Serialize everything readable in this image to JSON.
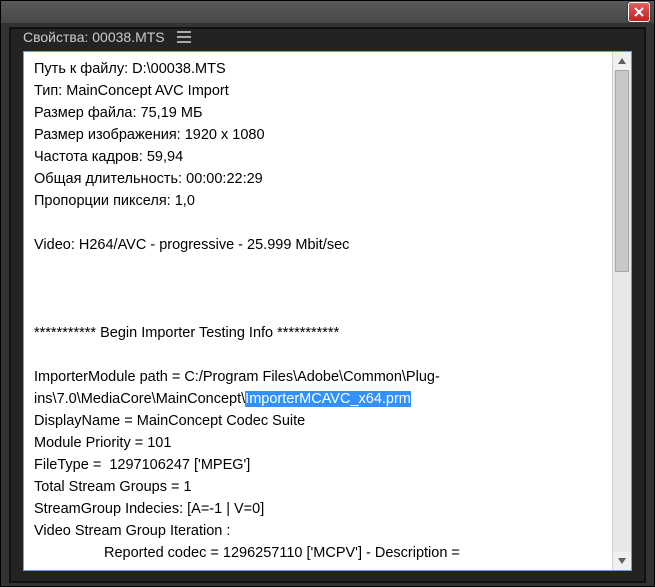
{
  "window": {
    "close_label": "Close"
  },
  "panel": {
    "title": "Свойства: 00038.MTS"
  },
  "props": {
    "file_path_label": "Путь к файлу:",
    "file_path_value": "D:\\00038.MTS",
    "type_label": "Тип:",
    "type_value": "MainConcept AVC Import",
    "file_size_label": "Размер файла:",
    "file_size_value": "75,19 МБ",
    "image_size_label": "Размер изображения:",
    "image_size_value": "1920 x 1080",
    "frame_rate_label": "Частота кадров:",
    "frame_rate_value": "59,94",
    "duration_label": "Общая длительность:",
    "duration_value": "00:00:22:29",
    "pixel_aspect_label": "Пропорции пикселя:",
    "pixel_aspect_value": "1,0",
    "video_line": "Video: H264/AVC - progressive - 25.999 Mbit/sec",
    "separator_line": "*********** Begin Importer Testing Info ***********",
    "importer_path_pre": "ImporterModule path = C:/Program Files\\Adobe\\Common\\Plug-ins\\7.0\\MediaCore\\MainConcept\\",
    "importer_path_highlight": "ImporterMCAVC_x64.prm",
    "display_name_line": "DisplayName = MainConcept Codec Suite",
    "module_priority_line": "Module Priority = 101",
    "file_type_line": "FileType =  1297106247 ['MPEG']",
    "total_stream_groups_line": "Total Stream Groups = 1",
    "stream_group_indices_line": "StreamGroup Indecies: [A=-1 | V=0]",
    "video_stream_group_line": "Video Stream Group Iteration :",
    "reported_codec_line": "Reported codec = 1296257110 ['MCPV'] - Description ="
  },
  "colors": {
    "selection": "#3390ff",
    "panel_bg": "#232323",
    "content_border": "#6aa0e0"
  }
}
